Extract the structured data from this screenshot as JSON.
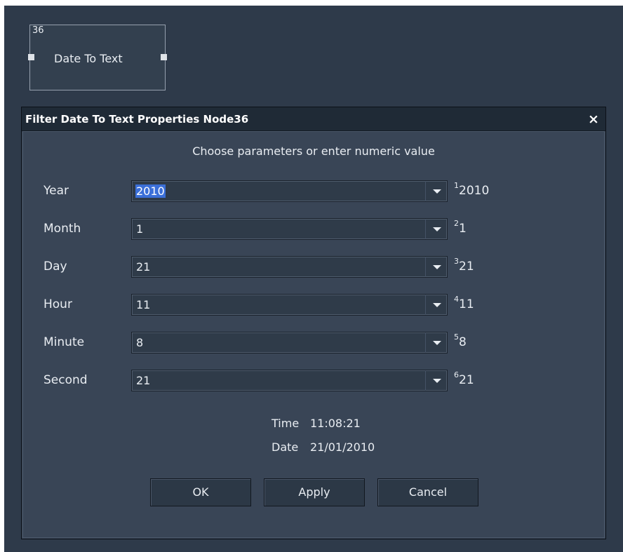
{
  "node": {
    "id": "36",
    "title": "Date To Text"
  },
  "dialog": {
    "title": "Filter Date To Text  Properties Node36",
    "close_label": "×",
    "heading": "Choose parameters or enter numeric value",
    "params": [
      {
        "label": "Year",
        "value": "2010",
        "index": "1",
        "numeric": "2010"
      },
      {
        "label": "Month",
        "value": "1",
        "index": "2",
        "numeric": "1"
      },
      {
        "label": "Day",
        "value": "21",
        "index": "3",
        "numeric": "21"
      },
      {
        "label": "Hour",
        "value": "11",
        "index": "4",
        "numeric": "11"
      },
      {
        "label": "Minute",
        "value": "8",
        "index": "5",
        "numeric": "8"
      },
      {
        "label": "Second",
        "value": "21",
        "index": "6",
        "numeric": "21"
      }
    ],
    "time_label": "Time",
    "time_value": "11:08:21",
    "date_label": "Date",
    "date_value": "21/01/2010",
    "buttons": {
      "ok": "OK",
      "apply": "Apply",
      "cancel": "Cancel"
    }
  }
}
